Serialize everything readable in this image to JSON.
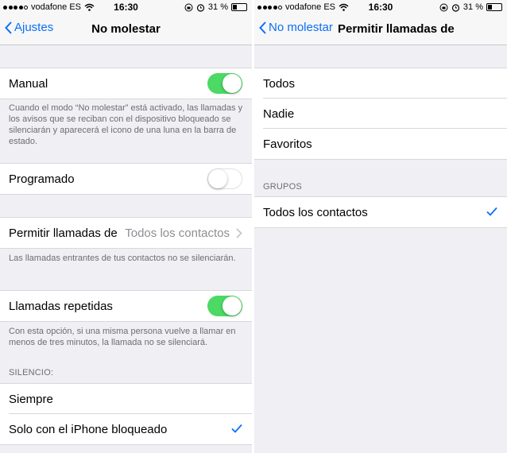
{
  "status": {
    "carrier": "vodafone ES",
    "time": "16:30",
    "battery": "31 %"
  },
  "left": {
    "back_label": "Ajustes",
    "title": "No molestar",
    "manual": {
      "label": "Manual",
      "on": true
    },
    "manual_note": "Cuando el modo “No molestar” está activado, las llamadas y los avisos que se reciban con el dispositivo bloqueado se silenciarán y aparecerá el icono de una luna en la barra de estado.",
    "scheduled": {
      "label": "Programado",
      "on": false
    },
    "allow_calls": {
      "label": "Permitir llamadas de",
      "value": "Todos los contactos"
    },
    "allow_note": "Las llamadas entrantes de tus contactos no se silenciarán.",
    "repeated": {
      "label": "Llamadas repetidas",
      "on": true
    },
    "repeated_note": "Con esta opción, si una misma persona vuelve a llamar en menos de tres minutos, la llamada no se silenciará.",
    "silence_header": "SILENCIO:",
    "silence_options": [
      "Siempre",
      "Solo con el iPhone bloqueado"
    ],
    "silence_selected": "Solo con el iPhone bloqueado"
  },
  "right": {
    "back_label": "No molestar",
    "title": "Permitir llamadas de",
    "options": [
      "Todos",
      "Nadie",
      "Favoritos"
    ],
    "groups_header": "GRUPOS",
    "group_option": "Todos los contactos",
    "selected": "Todos los contactos"
  },
  "colors": {
    "accent": "#0a6ff7",
    "toggle_on": "#4cd964",
    "background": "#efeff4"
  },
  "icons": [
    "signal-dots-icon",
    "wifi-icon",
    "lock-rotation-icon",
    "alarm-icon",
    "battery-icon",
    "chevron-left-icon",
    "chevron-right-icon",
    "checkmark-icon"
  ]
}
